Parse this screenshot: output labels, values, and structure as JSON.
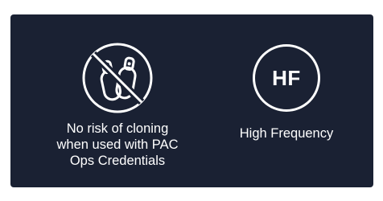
{
  "colors": {
    "card_background": "#1a2133",
    "foreground": "#ffffff"
  },
  "features": [
    {
      "icon": "no-cloning-key-fobs-icon",
      "caption_lines": [
        "No risk of cloning",
        "when used with PAC",
        "Ops Credentials"
      ]
    },
    {
      "icon": "high-frequency-badge-icon",
      "badge_text": "HF",
      "caption": "High Frequency"
    }
  ]
}
